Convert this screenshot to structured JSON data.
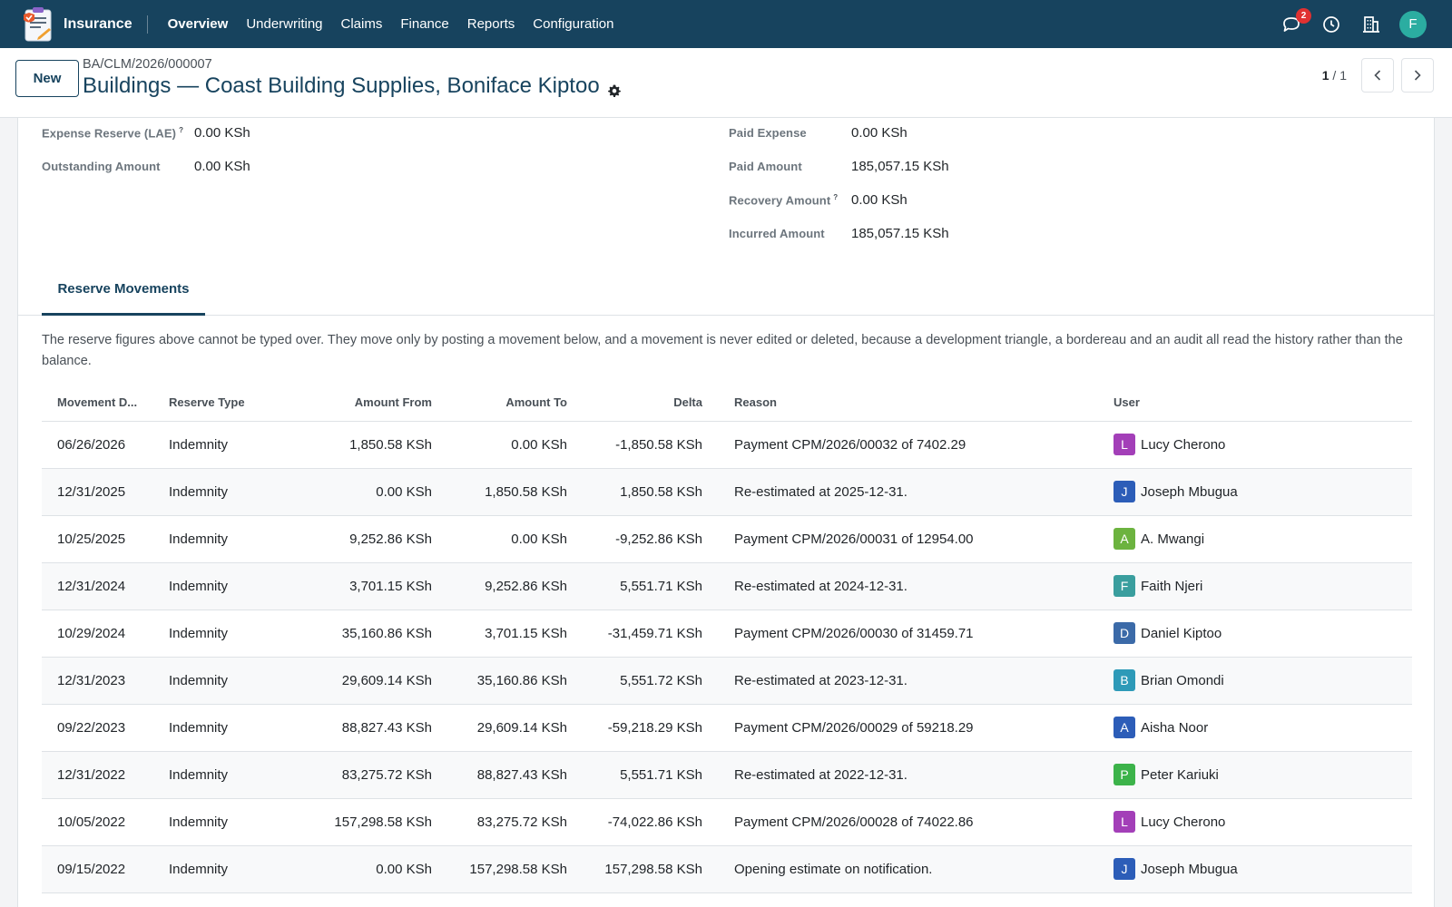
{
  "navbar": {
    "app_name": "Insurance",
    "menu": [
      {
        "label": "Overview"
      },
      {
        "label": "Underwriting"
      },
      {
        "label": "Claims"
      },
      {
        "label": "Finance"
      },
      {
        "label": "Reports"
      },
      {
        "label": "Configuration"
      }
    ],
    "messages_count": "2",
    "user_initial": "F",
    "icons": [
      "chat-icon",
      "clock-icon",
      "building-icon"
    ]
  },
  "control": {
    "new_label": "New",
    "breadcrumb": "BA/CLM/2026/000007",
    "title": "Buildings — Coast Building Supplies, Boniface Kiptoo",
    "pager_current": "1",
    "pager_sep": " / ",
    "pager_total": "1"
  },
  "fields_left": [
    {
      "label": "Expense Reserve (LAE)",
      "help": "?",
      "value": "0.00 KSh"
    },
    {
      "label": "Outstanding Amount",
      "help": "",
      "value": "0.00 KSh"
    }
  ],
  "fields_right": [
    {
      "label": "Paid Expense",
      "help": "",
      "value": "0.00 KSh"
    },
    {
      "label": "Paid Amount",
      "help": "",
      "value": "185,057.15 KSh"
    },
    {
      "label": "Recovery Amount",
      "help": "?",
      "value": "0.00 KSh"
    },
    {
      "label": "Incurred Amount",
      "help": "",
      "value": "185,057.15 KSh"
    }
  ],
  "tab": {
    "label": "Reserve Movements"
  },
  "note": "The reserve figures above cannot be typed over. They move only by posting a movement below, and a movement is never edited or deleted, because a development triangle, a bordereau and an audit all read the history rather than the balance.",
  "table": {
    "columns": [
      "Movement D...",
      "Reserve Type",
      "Amount From",
      "Amount To",
      "Delta",
      "Reason",
      "User"
    ],
    "rows": [
      {
        "date": "06/26/2026",
        "type": "Indemnity",
        "from": "1,850.58 KSh",
        "to": "0.00 KSh",
        "delta": "-1,850.58 KSh",
        "reason": "Payment CPM/2026/00032 of 7402.29",
        "initial": "L",
        "user": "Lucy Cherono",
        "color": "#a33fb8"
      },
      {
        "date": "12/31/2025",
        "type": "Indemnity",
        "from": "0.00 KSh",
        "to": "1,850.58 KSh",
        "delta": "1,850.58 KSh",
        "reason": "Re-estimated at 2025-12-31.",
        "initial": "J",
        "user": "Joseph Mbugua",
        "color": "#2c5db8"
      },
      {
        "date": "10/25/2025",
        "type": "Indemnity",
        "from": "9,252.86 KSh",
        "to": "0.00 KSh",
        "delta": "-9,252.86 KSh",
        "reason": "Payment CPM/2026/00031 of 12954.00",
        "initial": "A",
        "user": "A. Mwangi",
        "color": "#6cb33f"
      },
      {
        "date": "12/31/2024",
        "type": "Indemnity",
        "from": "3,701.15 KSh",
        "to": "9,252.86 KSh",
        "delta": "5,551.71 KSh",
        "reason": "Re-estimated at 2024-12-31.",
        "initial": "F",
        "user": "Faith Njeri",
        "color": "#3a9e9e"
      },
      {
        "date": "10/29/2024",
        "type": "Indemnity",
        "from": "35,160.86 KSh",
        "to": "3,701.15 KSh",
        "delta": "-31,459.71 KSh",
        "reason": "Payment CPM/2026/00030 of 31459.71",
        "initial": "D",
        "user": "Daniel Kiptoo",
        "color": "#3b6aa8"
      },
      {
        "date": "12/31/2023",
        "type": "Indemnity",
        "from": "29,609.14 KSh",
        "to": "35,160.86 KSh",
        "delta": "5,551.72 KSh",
        "reason": "Re-estimated at 2023-12-31.",
        "initial": "B",
        "user": "Brian Omondi",
        "color": "#2e9ab8"
      },
      {
        "date": "09/22/2023",
        "type": "Indemnity",
        "from": "88,827.43 KSh",
        "to": "29,609.14 KSh",
        "delta": "-59,218.29 KSh",
        "reason": "Payment CPM/2026/00029 of 59218.29",
        "initial": "A",
        "user": "Aisha Noor",
        "color": "#2c5db8"
      },
      {
        "date": "12/31/2022",
        "type": "Indemnity",
        "from": "83,275.72 KSh",
        "to": "88,827.43 KSh",
        "delta": "5,551.71 KSh",
        "reason": "Re-estimated at 2022-12-31.",
        "initial": "P",
        "user": "Peter Kariuki",
        "color": "#3cb34a"
      },
      {
        "date": "10/05/2022",
        "type": "Indemnity",
        "from": "157,298.58 KSh",
        "to": "83,275.72 KSh",
        "delta": "-74,022.86 KSh",
        "reason": "Payment CPM/2026/00028 of 74022.86",
        "initial": "L",
        "user": "Lucy Cherono",
        "color": "#a33fb8"
      },
      {
        "date": "09/15/2022",
        "type": "Indemnity",
        "from": "0.00 KSh",
        "to": "157,298.58 KSh",
        "delta": "157,298.58 KSh",
        "reason": "Opening estimate on notification.",
        "initial": "J",
        "user": "Joseph Mbugua",
        "color": "#2c5db8"
      }
    ]
  }
}
